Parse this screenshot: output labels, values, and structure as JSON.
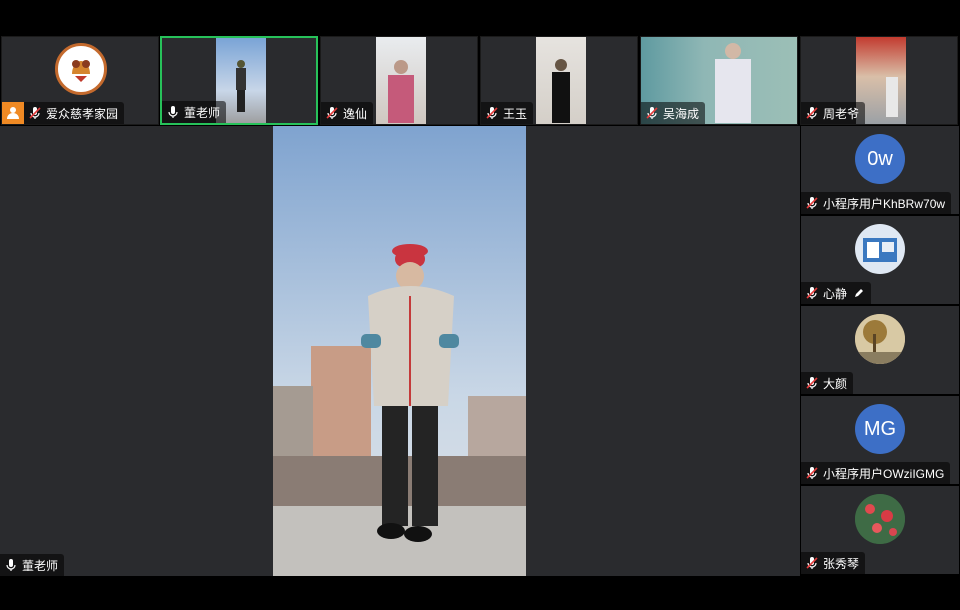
{
  "top_tiles": [
    {
      "name": "爱众慈孝家园",
      "mic": "muted",
      "host": true
    },
    {
      "name": "董老师",
      "mic": "on",
      "active": true
    },
    {
      "name": "逸仙",
      "mic": "muted"
    },
    {
      "name": "王玉",
      "mic": "muted"
    },
    {
      "name": "吴海成",
      "mic": "muted"
    },
    {
      "name": "周老爷",
      "mic": "muted"
    }
  ],
  "right_tiles": [
    {
      "name": "小程序用户KhBRw70w",
      "avatar_text": "0w",
      "avatar_color": "#3d6fc6",
      "mic": "muted"
    },
    {
      "name": "心静",
      "avatar_text": "",
      "mic": "muted",
      "editing": true
    },
    {
      "name": "大颜",
      "avatar_text": "",
      "mic": "muted"
    },
    {
      "name": "小程序用户OWziIGMG",
      "avatar_text": "MG",
      "avatar_color": "#3d6fc6",
      "mic": "muted"
    },
    {
      "name": "张秀琴",
      "avatar_text": "",
      "mic": "muted"
    }
  ],
  "main_speaker": {
    "name": "董老师",
    "mic": "on"
  },
  "colors": {
    "active_border": "#27c25a",
    "host_badge": "#f08a24",
    "tile_bg": "#2a2b2e"
  }
}
